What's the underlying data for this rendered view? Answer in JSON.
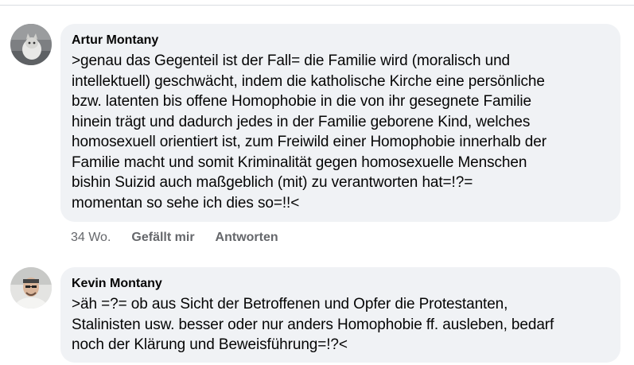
{
  "comments": [
    {
      "author": "Artur Montany",
      "text": ">genau das Gegenteil ist der Fall= die Familie wird (moralisch und\nintellektuell)  geschwächt, indem die katholische Kirche eine persönliche\nbzw. latenten bis offene  Homophobie in die von ihr gesegnete Familie\nhinein trägt und dadurch jedes in der Familie geborene Kind, welches\nhomosexuell orientiert ist, zum Freiwild einer Homophobie innerhalb der\nFamilie macht und somit Kriminalität gegen homosexuelle Menschen\nbishin Suizid  auch maßgeblich  (mit) zu verantworten hat=!?=\nmomentan so sehe ich dies so=!!<",
      "time": "34 Wo.",
      "like_label": "Gefällt mir",
      "reply_label": "Antworten"
    },
    {
      "author": "Kevin Montany",
      "text": ">äh =?=  ob aus Sicht der Betroffenen und Opfer die  Protestanten,\nStalinisten usw. besser oder nur anders Homophobie ff. ausleben, bedarf\nnoch der Klärung und Beweisführung=!?<"
    }
  ]
}
